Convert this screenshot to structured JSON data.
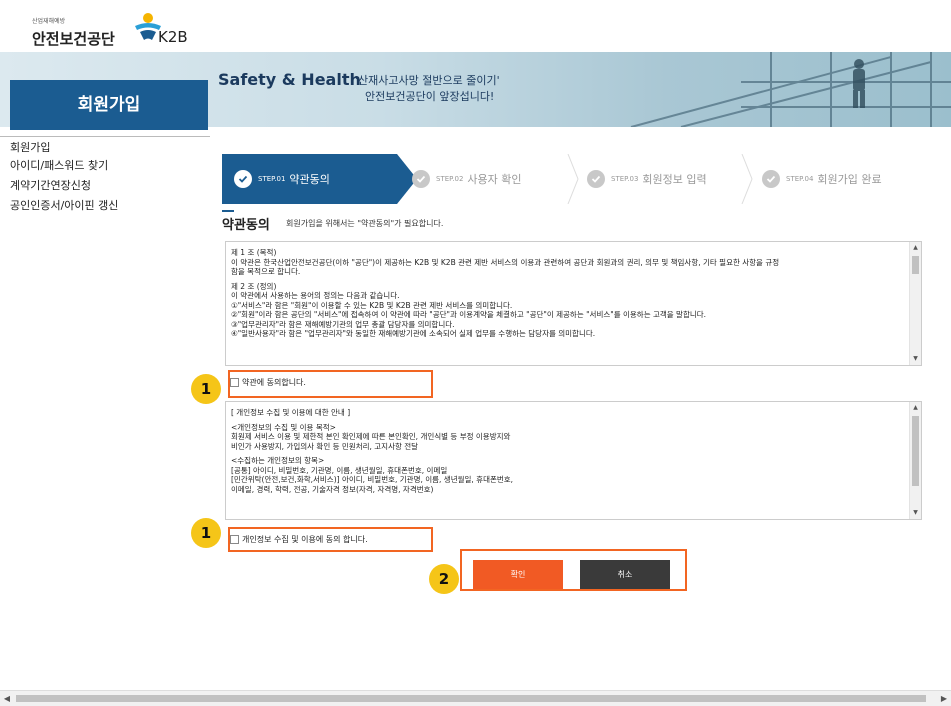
{
  "header": {
    "org_small": "산업재해예방",
    "org_name": "안전보건공단",
    "logo_text": "K2B"
  },
  "banner": {
    "tagline_en": "Safety & Health",
    "tagline_ko_1": "'산재사고사망 절반으로 줄이기'",
    "tagline_ko_2": "안전보건공단이 앞장섭니다!"
  },
  "page_title": "회원가입",
  "sidebar": {
    "items": [
      {
        "label": "회원가입"
      },
      {
        "label": "아이디/패스워드 찾기"
      },
      {
        "label": "계약기간연장신청"
      },
      {
        "label": "공인인증서/아이핀 갱신"
      }
    ]
  },
  "steps": [
    {
      "code": "STEP.01",
      "label": "약관동의",
      "active": true
    },
    {
      "code": "STEP.02",
      "label": "사용자 확인",
      "active": false
    },
    {
      "code": "STEP.03",
      "label": "회원정보 입력",
      "active": false
    },
    {
      "code": "STEP.04",
      "label": "회원가입 완료",
      "active": false
    }
  ],
  "section": {
    "title": "약관동의",
    "subtitle": "회원가입을 위해서는 \"약관동의\"가 필요합니다."
  },
  "terms": {
    "lines": [
      "제 1 조 (목적)",
      "이 약관은 한국산업안전보건공단(이하 \"공단\")이 제공하는 K2B 및 K2B 관련 제반 서비스의 이용과 관련하여 공단과 회원과의 권리, 의무 및 책임사항, 기타 필요한 사항을 규정",
      "함을 목적으로 합니다.",
      "",
      "제 2 조 (정의)",
      "이 약관에서 사용하는 용어의 정의는 다음과 같습니다.",
      "①\"서비스\"라 함은 \"회원\"이 이용할 수 있는 K2B 및 K2B 관련 제반 서비스를 의미합니다.",
      "②\"회원\"이라 함은 공단의 \"서비스\"에 접속하여 이 약관에 따라 \"공단\"과 이용계약을 체결하고 \"공단\"이 제공하는 \"서비스\"를 이용하는 고객을 말합니다.",
      "③\"업무관리자\"라 함은 재해예방기관의 업무 총괄 담당자를 의미합니다.",
      "④\"일반사용자\"라 함은 \"업무관리자\"와 동일한 재해예방기관에 소속되어 실제 업무를 수행하는 담당자를 의미합니다."
    ],
    "agree_label": "약관에 동의합니다."
  },
  "privacy": {
    "lines": [
      "[ 개인정보 수집 및 이용에 대한 안내 ]",
      "",
      "<개인정보의 수집 및 이용 목적>",
      "회원제 서비스 이용 및 제한적 본인 확인제에 따른 본인확인, 개인식별 등 부정 이용방지와",
      "비인가 사용방지, 가입의사 확인 등 민원처리, 고지사항 전달",
      "",
      "<수집하는 개인정보의 항목>",
      "[공통] 아이디, 비밀번호, 기관명, 이름, 생년월일, 휴대폰번호, 이메일",
      "[민간위탁(안전,보건,화학,서비스)] 아이디, 비밀번호, 기관명, 이름, 생년월일, 휴대폰번호,",
      "이메일, 경력, 학력, 전공, 기술자격 정보(자격, 자격명, 자격번호)"
    ],
    "agree_label": "개인정보 수집 및 이용에 동의 합니다."
  },
  "buttons": {
    "confirm": "확인",
    "cancel": "취소"
  },
  "annotations": {
    "badge_1": "1",
    "badge_2": "2"
  },
  "colors": {
    "primary": "#1b5c91",
    "confirm": "#f15a24",
    "cancel": "#3a3a3a",
    "highlight": "#f26522",
    "badge": "#f5c518"
  }
}
